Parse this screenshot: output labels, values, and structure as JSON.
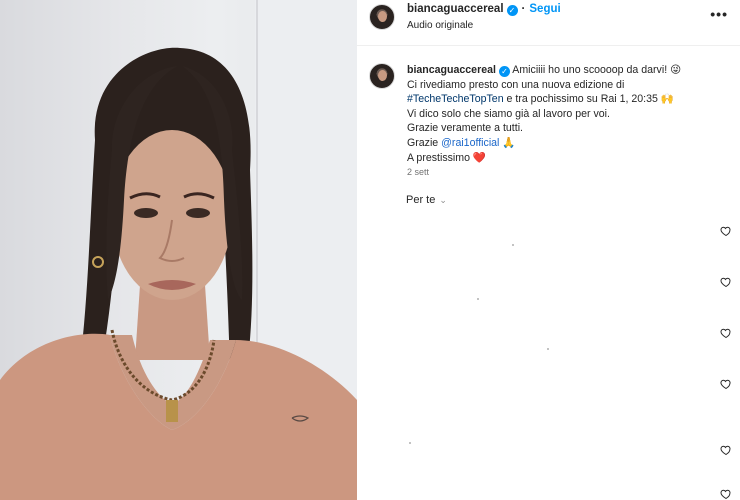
{
  "post": {
    "username": "biancaguaccereal",
    "verified_badge": "verified-badge-icon",
    "follow_label": "Segui",
    "audio_label": "Audio originale",
    "more_icon": "more-options-icon",
    "caption": {
      "username": "biancaguaccereal",
      "line1_rest": "Amiciiii ho uno scoooop da darvi! 😜",
      "line2": "Ci rivediamo presto con una nuova edizione di",
      "hashtag": "#TecheTecheTopTen",
      "line3_rest": " e tra pochissimo su Rai 1, 20:35 🙌",
      "line4": "Vi dico solo che siamo già al lavoro per voi.",
      "line5": "Grazie veramente a tutti.",
      "line6_prefix": "Grazie ",
      "mention": "@rai1official",
      "line6_suffix": " 🙏",
      "line7": "A prestissimo ❤️"
    },
    "time_ago": "2 sett",
    "for_you_label": "Per te"
  },
  "comment_like_icons": [
    "heart-icon",
    "heart-icon",
    "heart-icon",
    "heart-icon",
    "heart-icon",
    "heart-icon"
  ],
  "colors": {
    "accent": "#0095f6",
    "hashtag": "#00376b",
    "mention": "#1a66c9"
  }
}
